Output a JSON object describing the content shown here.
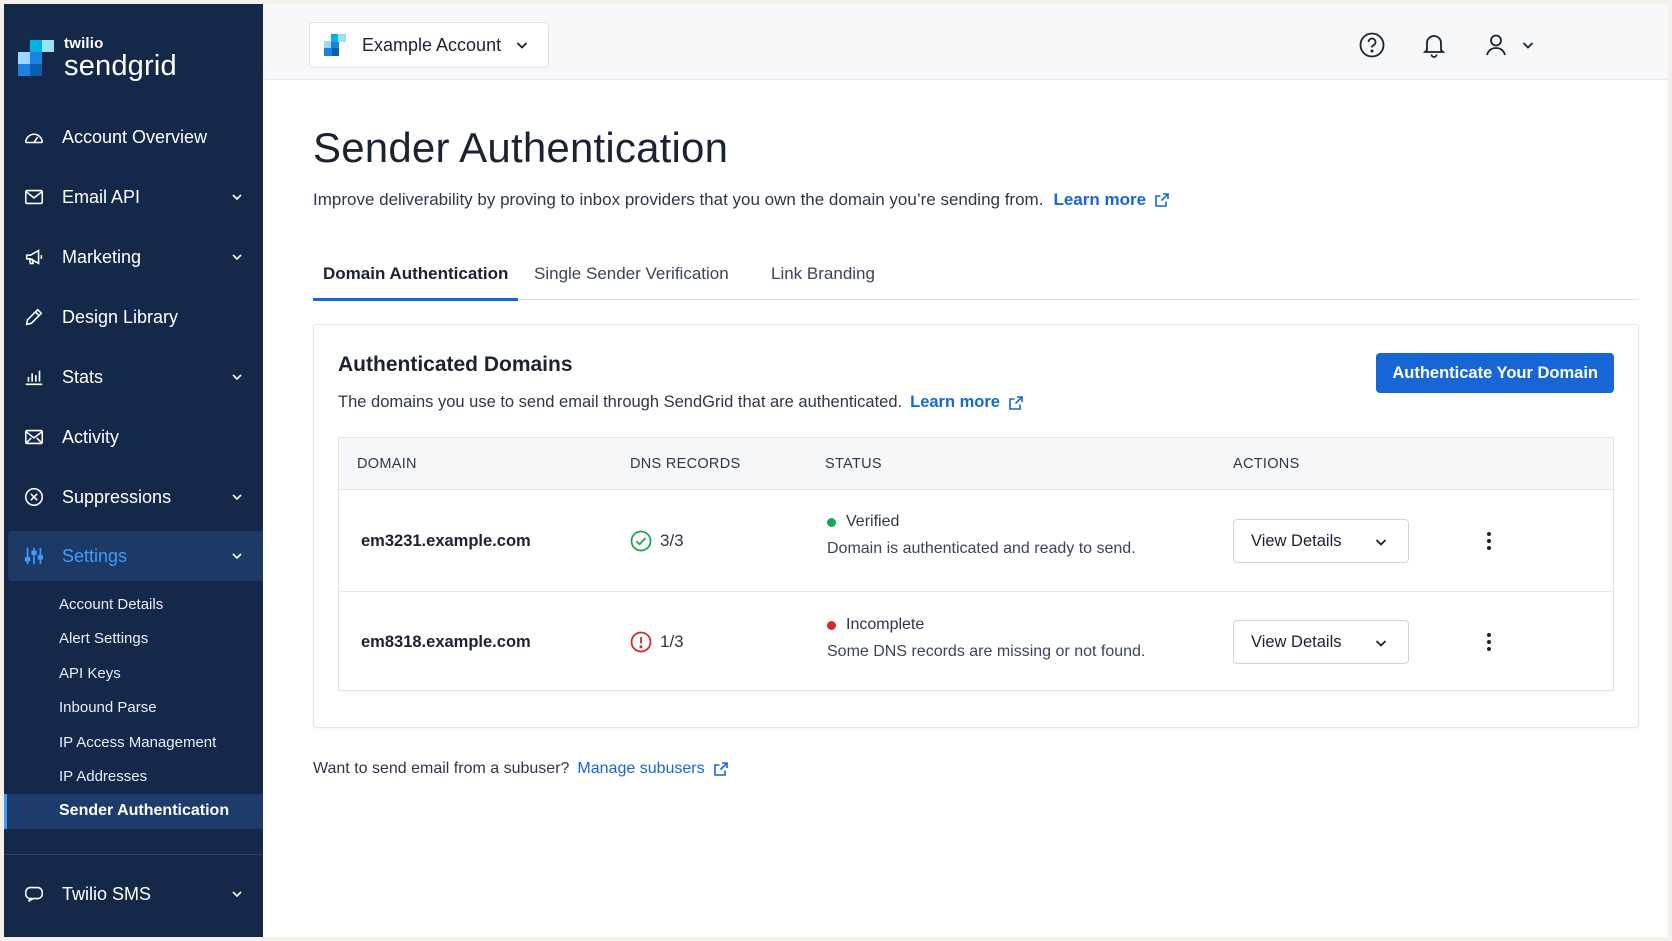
{
  "brand": {
    "name_top": "twilio",
    "name_bottom": "sendgrid",
    "colors": {
      "sidebar": "#14294a",
      "accent": "#1766d6",
      "active_nav": "#3d9cff",
      "verified": "#1aa653",
      "incomplete": "#d62828"
    }
  },
  "sidebar": {
    "items": [
      {
        "label": "Account Overview",
        "icon": "dashboard-icon",
        "expandable": false
      },
      {
        "label": "Email API",
        "icon": "envelope-icon",
        "expandable": true
      },
      {
        "label": "Marketing",
        "icon": "megaphone-icon",
        "expandable": true
      },
      {
        "label": "Design Library",
        "icon": "pencil-icon",
        "expandable": false
      },
      {
        "label": "Stats",
        "icon": "bar-chart-icon",
        "expandable": true
      },
      {
        "label": "Activity",
        "icon": "envelope-activity-icon",
        "expandable": false
      },
      {
        "label": "Suppressions",
        "icon": "circle-x-icon",
        "expandable": true
      },
      {
        "label": "Settings",
        "icon": "sliders-icon",
        "expandable": true,
        "active": true
      }
    ],
    "settings_subitems": [
      "Account Details",
      "Alert Settings",
      "API Keys",
      "Inbound Parse",
      "IP Access Management",
      "IP Addresses",
      "Sender Authentication"
    ],
    "selected_subitem": "Sender Authentication",
    "bottom_item": {
      "label": "Twilio SMS",
      "icon": "chat-bubble-icon",
      "expandable": true
    }
  },
  "topbar": {
    "account_name": "Example Account",
    "icons": [
      "help-icon",
      "bell-icon",
      "user-icon"
    ]
  },
  "page": {
    "title": "Sender Authentication",
    "intro": "Improve deliverability by proving to inbox providers that you own the domain you’re sending from.",
    "intro_link": "Learn more"
  },
  "tabs": [
    {
      "label": "Domain Authentication",
      "active": true
    },
    {
      "label": "Single Sender Verification",
      "active": false
    },
    {
      "label": "Link Branding",
      "active": false
    }
  ],
  "card": {
    "title": "Authenticated Domains",
    "description": "The domains you use to send email through SendGrid that are authenticated.",
    "description_link": "Learn more",
    "primary_button": "Authenticate Your Domain",
    "columns": [
      "DOMAIN",
      "DNS RECORDS",
      "STATUS",
      "ACTIONS"
    ],
    "rows": [
      {
        "domain": "em3231.example.com",
        "dns_records": "3/3",
        "dns_state": "ok",
        "status": "Verified",
        "status_color": "#1aa653",
        "status_desc": "Domain is authenticated and ready to send.",
        "action": "View Details"
      },
      {
        "domain": "em8318.example.com",
        "dns_records": "1/3",
        "dns_state": "error",
        "status": "Incomplete",
        "status_color": "#d62828",
        "status_desc": "Some DNS records are missing or not found.",
        "action": "View Details"
      }
    ]
  },
  "footer": {
    "question": "Want to send email from a subuser?",
    "link": "Manage subusers"
  }
}
